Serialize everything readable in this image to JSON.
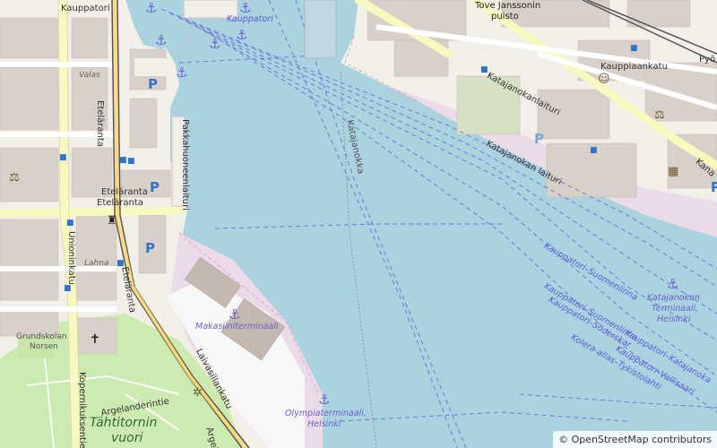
{
  "map": {
    "streets": {
      "kauppatori_top": "Kauppatori",
      "kauppatori_italic": "Kauppatori",
      "valas": "Valas",
      "etelaranta_vertical": "Eteläranta",
      "pakkahuoneenlaituri": "Pakkahuoneenlaituri",
      "etelaranta_label": "Eteläranta",
      "etelaranta_stop": "Eteläranta",
      "unioninkatu": "Unioninkatu",
      "lahna": "Lahna",
      "etelaranta_lower": "Eteläranta",
      "laivasillankatu": "Laivasillankatu",
      "argelanderintie": "Argelanderintie",
      "kopernikuksentie": "Kopernikuksentie",
      "argelander_short": "Argel",
      "katajanokka": "Katajanokka",
      "katajanokanlaituri": "Katajanokanlaituri",
      "katajanokan_laituri": "Katajanokan laituri",
      "kauppiaankatu": "Kauppiaankatu",
      "tove_jansson": "Tove Janssonin",
      "puisto": "puisto",
      "pyo": "Pyö",
      "kana": "Kana"
    },
    "places": {
      "grundskolan": "Grundskolan",
      "norsen": "Norsen",
      "tahtitornin": "Tähtitornin",
      "vuori": "vuori",
      "makasiiniterminaali": "Makasiiniterminaali",
      "olympiaterminaali": "Olympiaterminaali,",
      "olympia_city": "Helsinki",
      "katajanokan_terminaali": "Katajanokan",
      "katajanokan_terminaali2": "Terminaali,",
      "katajanokan_city": "Helsinki"
    },
    "ferry_routes": {
      "r1": "Kauppatori–Suomenlinna",
      "r2": "Kauppatori–Suomenlinna",
      "r3": "Kauppatori–Katajanoka",
      "r4": "Kauppatori–Vallisaari",
      "r5": "Kauppatori–Soderskar",
      "r6": "Kolera-allas–Tykistolahti"
    },
    "parking_label": "P",
    "attribution": "© OpenStreetMap contributors",
    "colors": {
      "water": "#aad3df",
      "land": "#f2efe9",
      "building": "#d9d0c9",
      "park": "#cdebb0",
      "industrial": "#ebdbe8",
      "road_major": "#f7fabf",
      "route_blue": "#5b5bd6"
    },
    "icons": [
      "anchor-icon",
      "parking-icon",
      "bus-stop-icon",
      "cinema-icon",
      "courthouse-icon",
      "church-icon",
      "monument-icon",
      "viewpoint-icon"
    ]
  }
}
